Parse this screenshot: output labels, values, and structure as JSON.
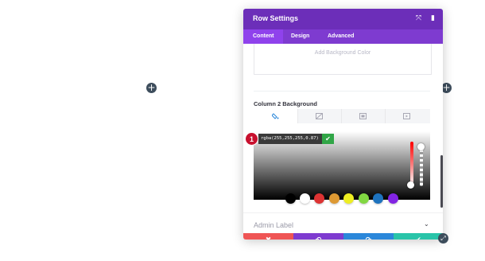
{
  "canvas": {
    "add_left_icon": "+",
    "add_right_icon": "+"
  },
  "modal": {
    "title": "Row Settings",
    "header_icons": {
      "expand": "⤧",
      "sidebar": "▮"
    },
    "tabs": [
      {
        "label": "Content",
        "active": true
      },
      {
        "label": "Design",
        "active": false
      },
      {
        "label": "Advanced",
        "active": false
      }
    ],
    "background_color_placeholder": "Add Background Color",
    "section_label": "Column 2 Background",
    "background_tabs": [
      {
        "name": "color-tab",
        "active": true
      },
      {
        "name": "gradient-tab",
        "active": false
      },
      {
        "name": "image-tab",
        "active": false
      },
      {
        "name": "video-tab",
        "active": false
      }
    ],
    "color_value": "rgba(255,255,255,0.87)",
    "color_ok_icon": "✔",
    "step_number": "1",
    "swatches": [
      "#000000",
      "#ffffff",
      "#dd3333",
      "#dd9933",
      "#eeee22",
      "#81d742",
      "#1e73be",
      "#8224e3"
    ],
    "admin_label": "Admin Label",
    "admin_chevron": "⌄",
    "footer": {
      "cancel_icon": "✖",
      "undo_icon": "↶",
      "redo_icon": "↷",
      "save_icon": "✔",
      "colors": {
        "cancel": "#ef5555",
        "undo": "#7e3bd0",
        "redo": "#2b87da",
        "save": "#29c4a9"
      }
    }
  },
  "resize_icon": "⤢"
}
